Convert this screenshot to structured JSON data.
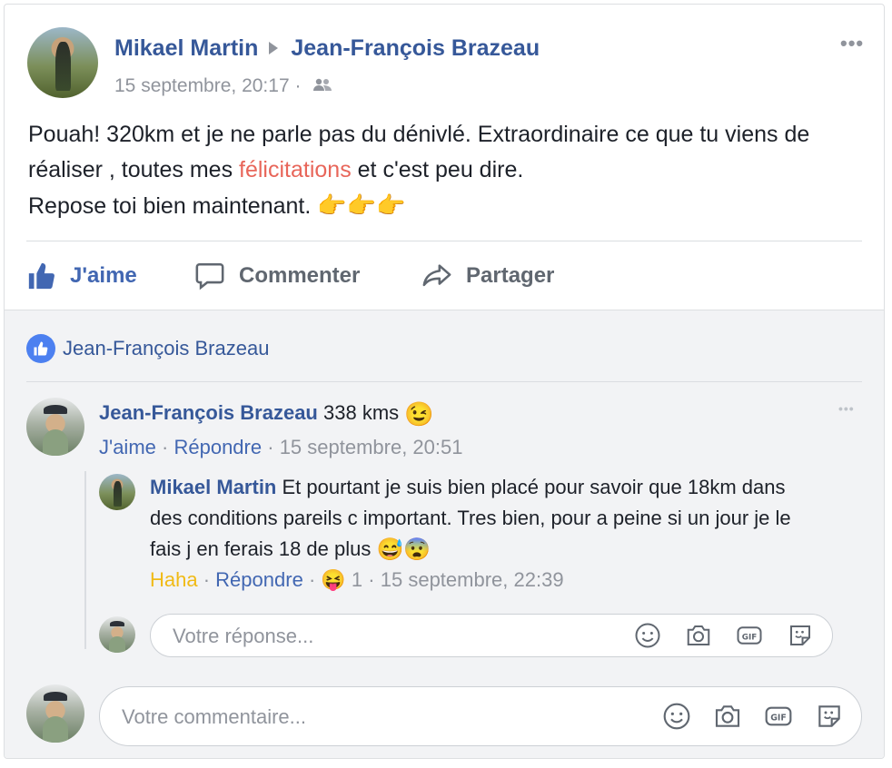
{
  "post": {
    "author": "Mikael Martin",
    "target": "Jean-François Brazeau",
    "timestamp": "15 septembre, 20:17",
    "separator": "·",
    "privacy_icon": "friends-icon",
    "more_icon": "more-options-icon",
    "text_part1": "Pouah! 320km et je ne parle pas du dénivlé. Extraordinaire ce que tu viens de réaliser , toutes mes ",
    "text_highlight": "félicitations",
    "text_part2": " et c'est peu dire.",
    "text_line3": "Repose toi bien maintenant.",
    "text_emoji": "👉👉👉"
  },
  "actions": {
    "like_label": "J'aime",
    "comment_label": "Commenter",
    "share_label": "Partager"
  },
  "likes": {
    "names": "Jean-François Brazeau"
  },
  "comments": [
    {
      "author": "Jean-François Brazeau",
      "text": "338 kms",
      "emoji": "😉",
      "like_label": "J'aime",
      "reply_label": "Répondre",
      "timestamp": "15 septembre, 20:51",
      "replies": [
        {
          "author": "Mikael Martin",
          "text": "Et pourtant je suis bien placé pour savoir que 18km dans des conditions pareils c important. Tres bien, pour a peine si un jour je le fais j en ferais 18 de plus",
          "emoji": "😅😨",
          "reaction_label": "Haha",
          "reply_label": "Répondre",
          "reaction_emoji": "😝",
          "reaction_count": "1",
          "timestamp": "15 septembre, 22:39"
        }
      ]
    }
  ],
  "reply_input": {
    "placeholder": "Votre réponse..."
  },
  "comment_input": {
    "placeholder": "Votre commentaire..."
  },
  "colors": {
    "link": "#365899",
    "liked": "#4267b2",
    "highlight": "#e8665a",
    "haha": "#f0ba15",
    "muted": "#90949c"
  }
}
